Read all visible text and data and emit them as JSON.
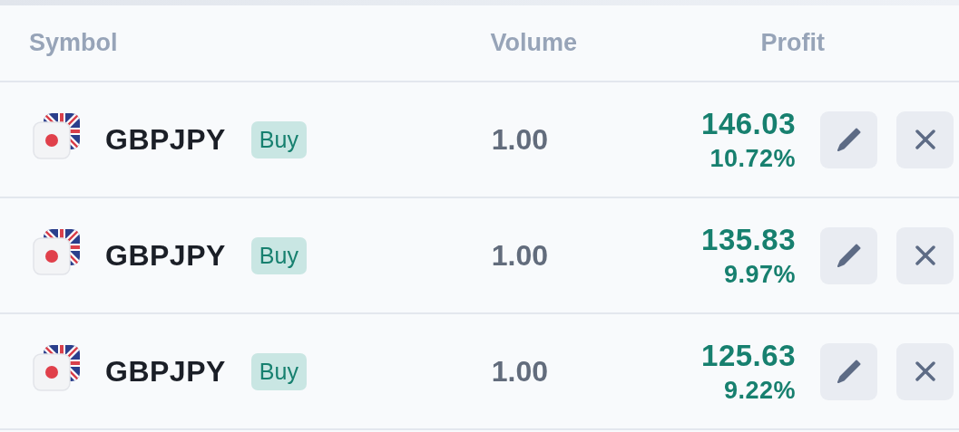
{
  "columns": [
    "Symbol",
    "Volume",
    "Profit"
  ],
  "positions": [
    {
      "symbol": "GBPJPY",
      "side": "Buy",
      "volume": "1.00",
      "profit": "146.03",
      "percent": "10.72%"
    },
    {
      "symbol": "GBPJPY",
      "side": "Buy",
      "volume": "1.00",
      "profit": "135.83",
      "percent": "9.97%"
    },
    {
      "symbol": "GBPJPY",
      "side": "Buy",
      "volume": "1.00",
      "profit": "125.63",
      "percent": "9.22%"
    }
  ]
}
